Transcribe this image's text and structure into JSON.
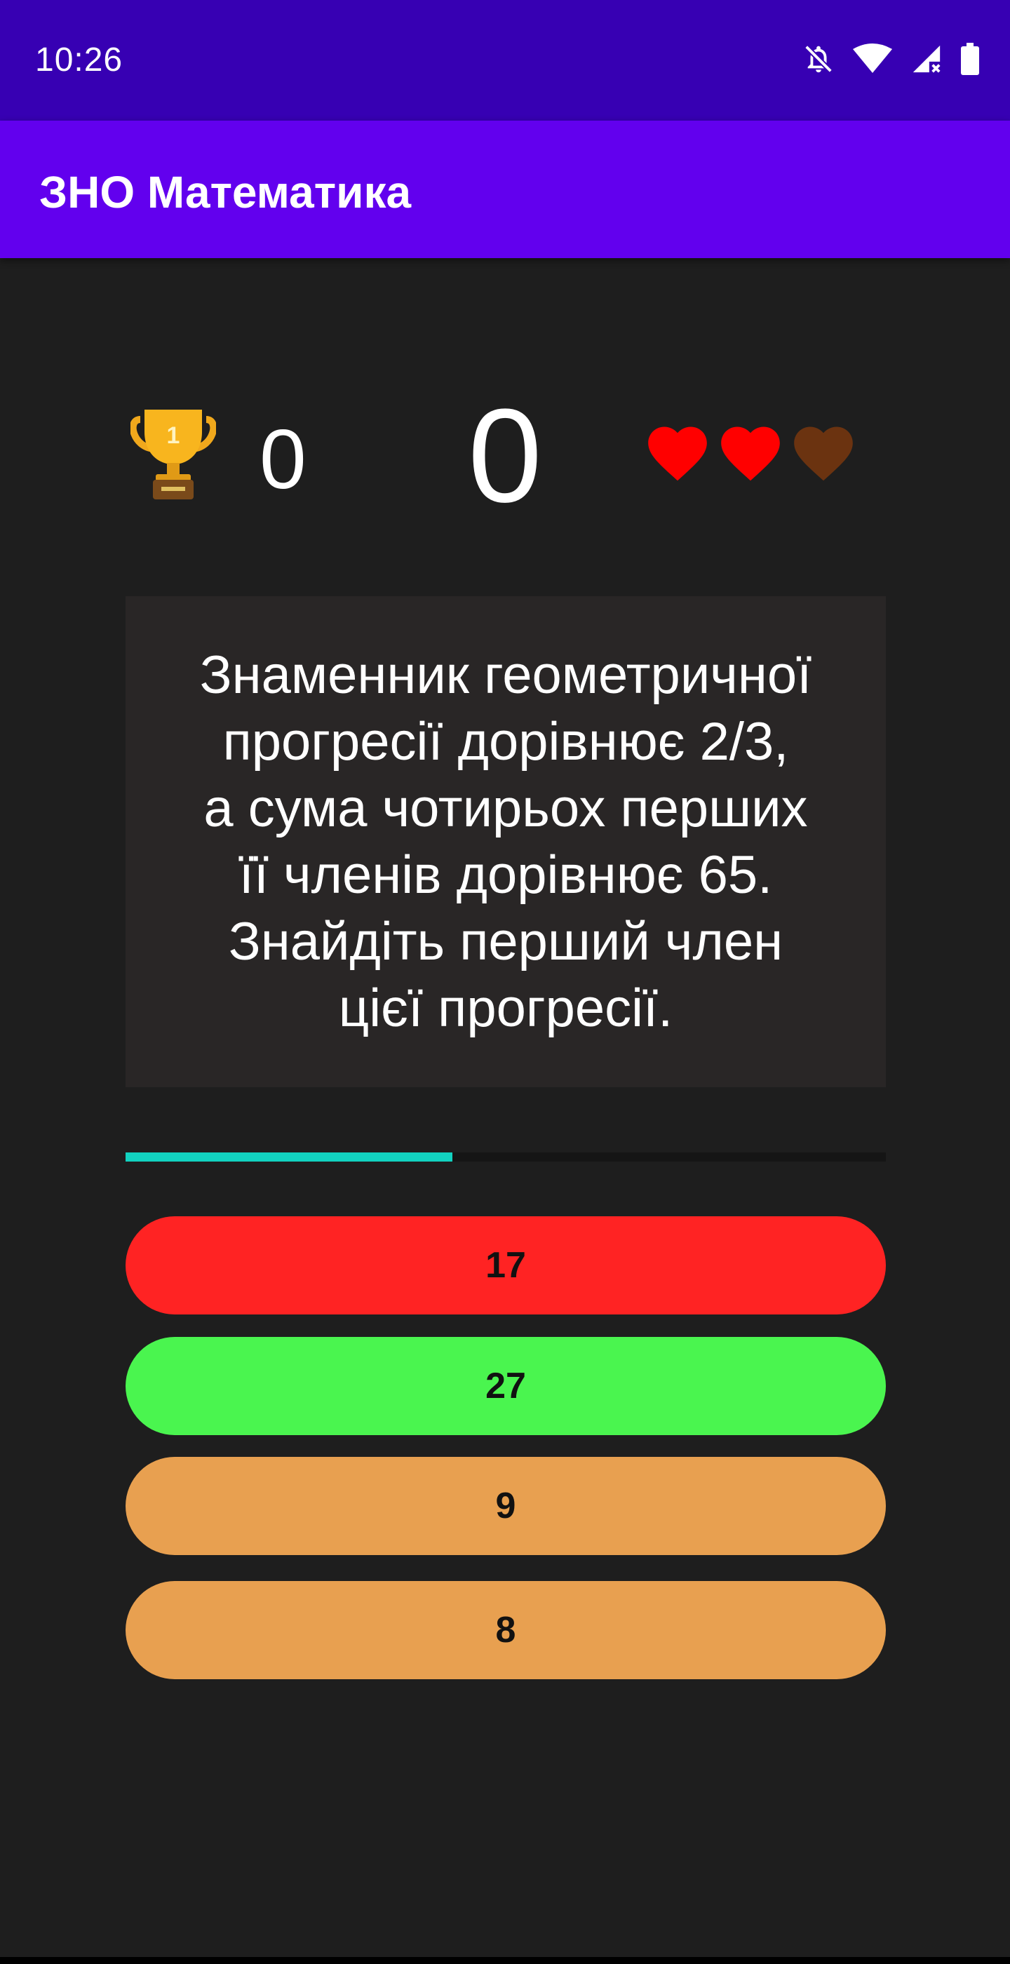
{
  "status_bar": {
    "time": "10:26",
    "icons": [
      "notifications-off-icon",
      "wifi-icon",
      "cellular-no-signal-icon",
      "battery-icon"
    ]
  },
  "app_bar": {
    "title": "ЗНО Математика"
  },
  "score": {
    "trophy_icon": "trophy-icon",
    "trophy_badge": "1",
    "best": "0",
    "current": "0"
  },
  "lives": {
    "total": 3,
    "remaining": 2,
    "full_color": "#ff0000",
    "empty_color": "#6b3310"
  },
  "question": {
    "text": "Знаменник геометричної\nпрогресії дорівнює 2/3,\nа сума чотирьох перших\nїї членів дорівнює 65.\nЗнайдіть перший член\nцієї прогресії."
  },
  "progress": {
    "fraction": 0.43,
    "color": "#12d2c0"
  },
  "answers": [
    {
      "label": "17",
      "state": "wrong",
      "color": "#ff2323"
    },
    {
      "label": "27",
      "state": "correct",
      "color": "#4af54f"
    },
    {
      "label": "9",
      "state": "neutral",
      "color": "#e8a050"
    },
    {
      "label": "8",
      "state": "neutral",
      "color": "#e8a050"
    }
  ]
}
